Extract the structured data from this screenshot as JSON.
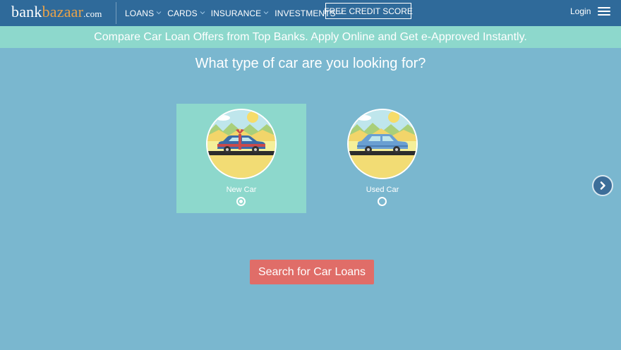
{
  "header": {
    "logo": {
      "part1": "bank",
      "part2": "bazaar",
      "part3": ".com"
    },
    "nav": [
      {
        "label": "LOANS",
        "dropdown": true
      },
      {
        "label": "CARDS",
        "dropdown": true
      },
      {
        "label": "INSURANCE",
        "dropdown": true
      },
      {
        "label": "INVESTMENTS",
        "dropdown": true
      }
    ],
    "credit_button": "FREE CREDIT SCORE",
    "login": "Login",
    "menu_icon": "hamburger-menu-icon"
  },
  "banner": {
    "text": "Compare Car Loan Offers from Top Banks. Apply Online and Get e-Approved Instantly."
  },
  "main": {
    "question": "What type of car are you looking for?",
    "options": [
      {
        "label": "New Car",
        "selected": true,
        "icon": "new-car-icon"
      },
      {
        "label": "Used Car",
        "selected": false,
        "icon": "used-car-icon"
      }
    ],
    "next_icon": "chevron-right-icon",
    "search_button": "Search for Car Loans"
  },
  "colors": {
    "header_bg": "#2f6a9a",
    "banner_bg": "#8dd8cc",
    "page_bg": "#7ab7cf",
    "selected_card_bg": "#8dd8cc",
    "search_button_bg": "#e06d68",
    "logo_accent": "#e8a24a"
  }
}
